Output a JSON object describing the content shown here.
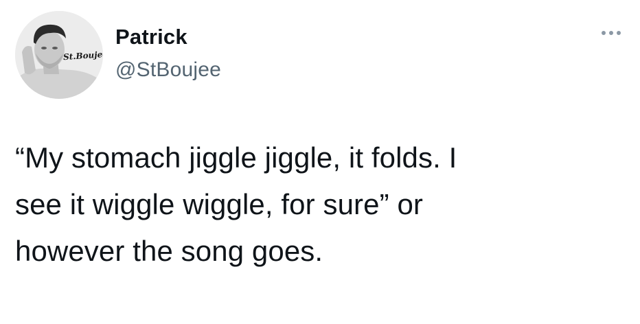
{
  "author": {
    "name": "Patrick",
    "handle": "@StBoujee",
    "avatar_watermark": "St.Boujee"
  },
  "menu": {
    "icon": "more-horizontal-icon"
  },
  "tweet": {
    "text": "“My stomach jiggle jiggle, it folds. I\nsee it wiggle wiggle, for sure” or\nhowever the song goes."
  },
  "colors": {
    "text": "#0f1419",
    "secondary": "#536471",
    "menu_dots": "#8b98a5"
  }
}
